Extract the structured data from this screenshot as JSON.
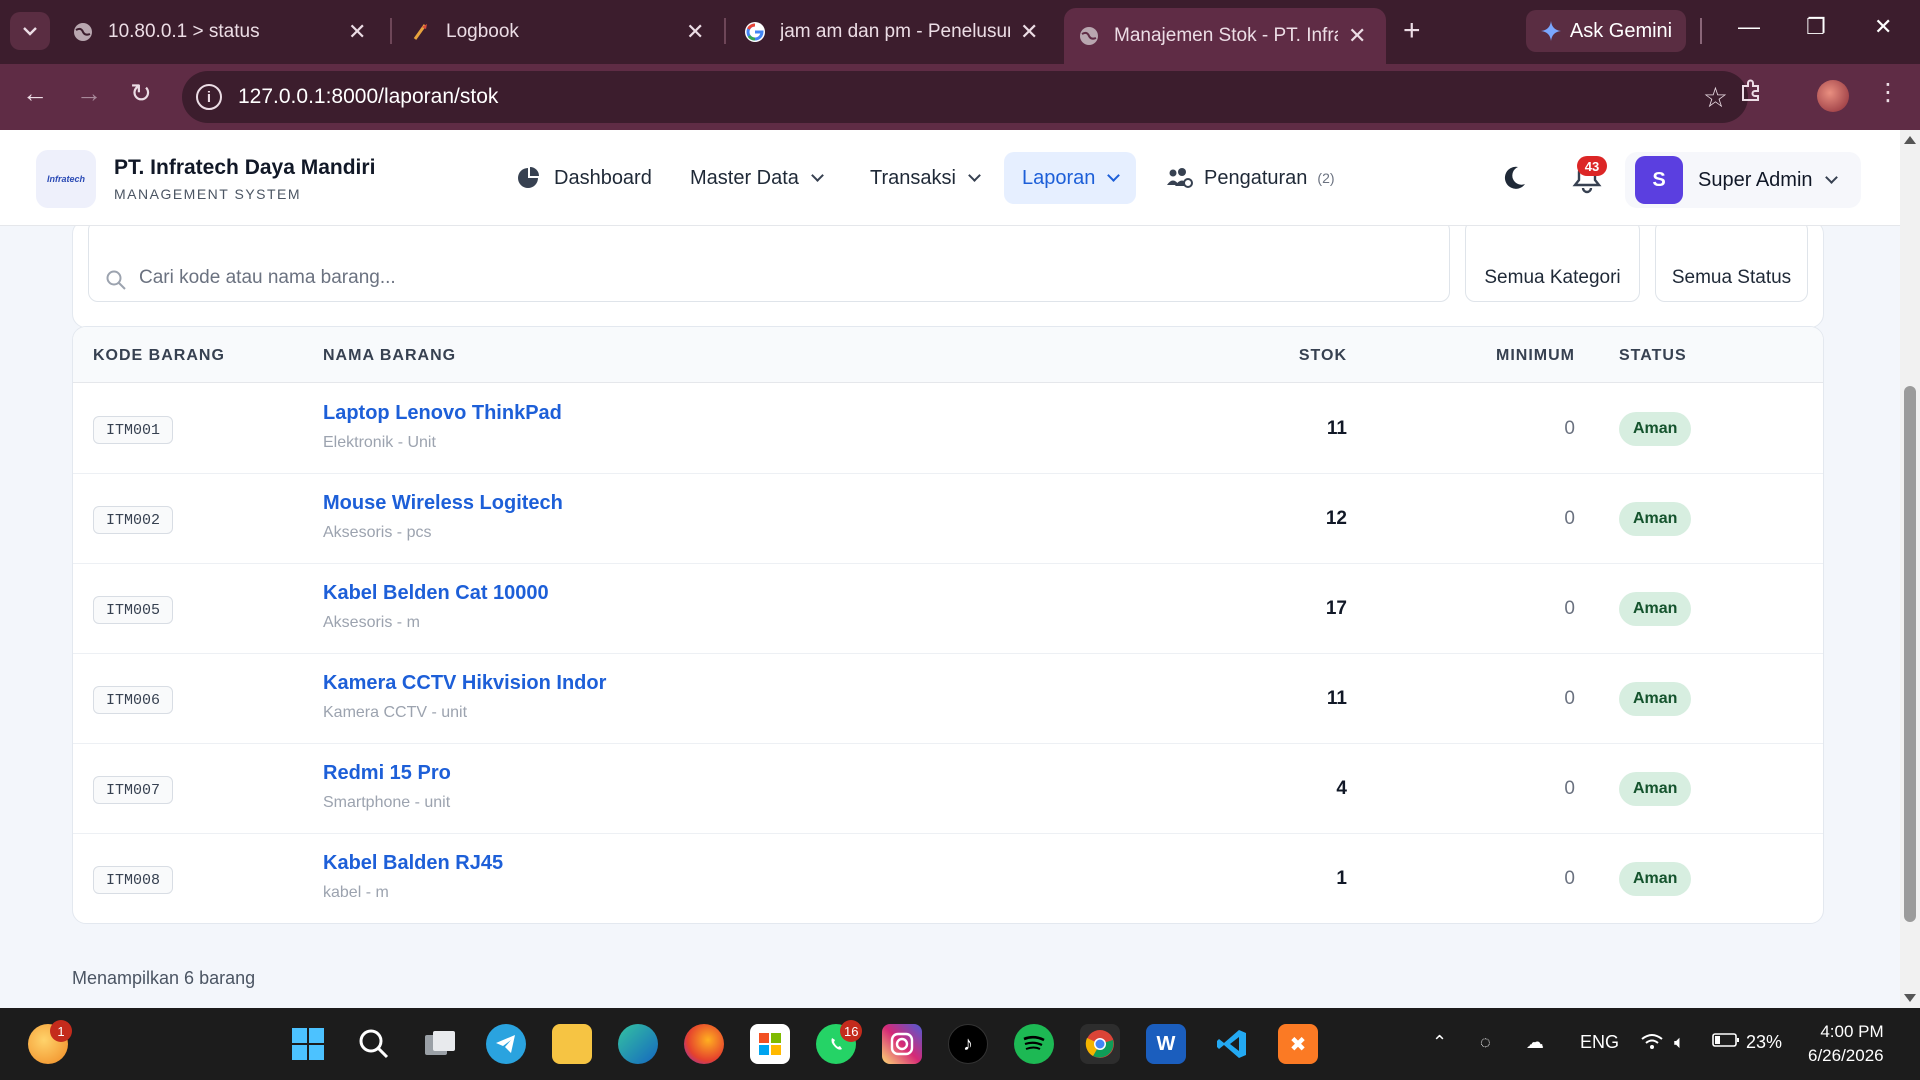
{
  "browser": {
    "tabs": [
      {
        "title": "10.80.0.1 > status",
        "icon": "globe-icon"
      },
      {
        "title": "Logbook",
        "icon": "logbook-icon"
      },
      {
        "title": "jam am dan pm - Penelusuran",
        "icon": "google-icon"
      },
      {
        "title": "Manajemen Stok - PT. Infratech",
        "icon": "globe-icon",
        "active": true
      }
    ],
    "new_tab": "+",
    "gemini_label": "Ask Gemini",
    "url": "127.0.0.1:8000/laporan/stok"
  },
  "header": {
    "logo_text": "Infratech",
    "brand_name": "PT. Infratech Daya Mandiri",
    "brand_sub": "MANAGEMENT SYSTEM",
    "menu": [
      {
        "label": "Dashboard",
        "icon": "dashboard-icon"
      },
      {
        "label": "Master Data"
      },
      {
        "label": "Transaksi"
      },
      {
        "label": "Laporan",
        "active": true
      },
      {
        "label": "Pengaturan",
        "count": "(2)",
        "icon": "users-cog-icon"
      }
    ],
    "notif_count": "43",
    "user_initial": "S",
    "user_name": "Super Admin"
  },
  "filters": {
    "search_placeholder": "Cari kode atau nama barang...",
    "category": "Semua Kategori",
    "status": "Semua Status"
  },
  "table": {
    "headers": {
      "kode": "KODE BARANG",
      "nama": "NAMA BARANG",
      "stok": "STOK",
      "minimum": "MINIMUM",
      "status": "STATUS"
    },
    "rows": [
      {
        "kode": "ITM001",
        "nama": "Laptop Lenovo ThinkPad",
        "sub": "Elektronik - Unit",
        "stok": "11",
        "minimum": "0",
        "status": "Aman"
      },
      {
        "kode": "ITM002",
        "nama": "Mouse Wireless Logitech",
        "sub": "Aksesoris - pcs",
        "stok": "12",
        "minimum": "0",
        "status": "Aman"
      },
      {
        "kode": "ITM005",
        "nama": "Kabel Belden Cat 10000",
        "sub": "Aksesoris - m",
        "stok": "17",
        "minimum": "0",
        "status": "Aman"
      },
      {
        "kode": "ITM006",
        "nama": "Kamera CCTV Hikvision Indor",
        "sub": "Kamera CCTV - unit",
        "stok": "11",
        "minimum": "0",
        "status": "Aman"
      },
      {
        "kode": "ITM007",
        "nama": "Redmi 15 Pro",
        "sub": "Smartphone - unit",
        "stok": "4",
        "minimum": "0",
        "status": "Aman"
      },
      {
        "kode": "ITM008",
        "nama": "Kabel Balden RJ45",
        "sub": "kabel - m",
        "stok": "1",
        "minimum": "0",
        "status": "Aman"
      }
    ]
  },
  "footer_note": "Menampilkan 6 barang",
  "taskbar": {
    "weather_badge": "1",
    "whatsapp_badge": "16",
    "language": "ENG",
    "battery": "23%",
    "time": "4:00 PM",
    "date": "6/26/2026"
  },
  "colors": {
    "chrome_dark": "#3c1d2d",
    "chrome_active": "#5f2c45",
    "accent_blue": "#1d5fd8",
    "status_green_bg": "#d7eee0",
    "badge_red": "#dc2626"
  }
}
